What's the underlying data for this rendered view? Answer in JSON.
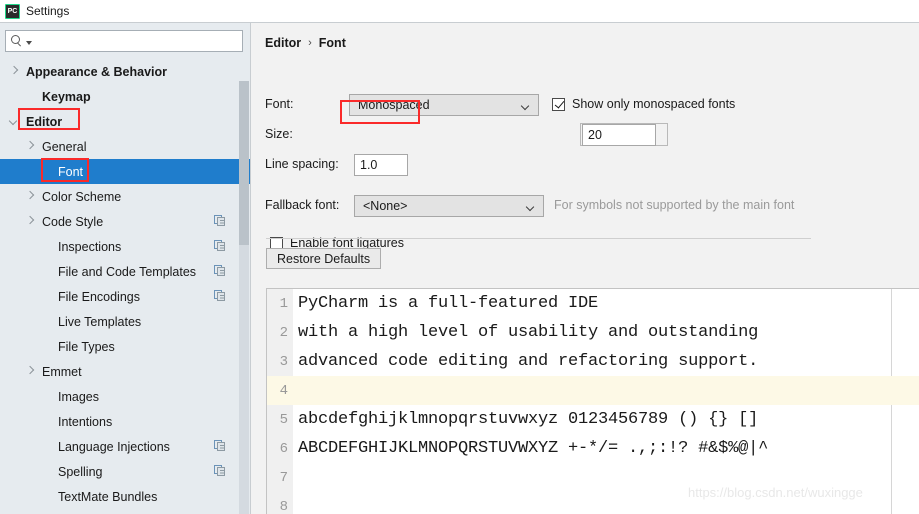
{
  "window": {
    "title": "Settings",
    "app_icon": "pycharm-icon",
    "icon_text": "PC"
  },
  "sidebar": {
    "search": {
      "value": "",
      "placeholder": "",
      "icon": "search-icon"
    },
    "items": [
      {
        "label": "Appearance & Behavior",
        "indent": 0,
        "arrow": "right",
        "bold": true,
        "selected": false,
        "copy_icon": false
      },
      {
        "label": "Keymap",
        "indent": 1,
        "arrow": "none",
        "bold": true,
        "selected": false,
        "copy_icon": false
      },
      {
        "label": "Editor",
        "indent": 0,
        "arrow": "down",
        "bold": true,
        "selected": false,
        "copy_icon": false
      },
      {
        "label": "General",
        "indent": 1,
        "arrow": "right",
        "bold": false,
        "selected": false,
        "copy_icon": false
      },
      {
        "label": "Font",
        "indent": 2,
        "arrow": "none",
        "bold": false,
        "selected": true,
        "copy_icon": false
      },
      {
        "label": "Color Scheme",
        "indent": 1,
        "arrow": "right",
        "bold": false,
        "selected": false,
        "copy_icon": false
      },
      {
        "label": "Code Style",
        "indent": 1,
        "arrow": "right",
        "bold": false,
        "selected": false,
        "copy_icon": true
      },
      {
        "label": "Inspections",
        "indent": 2,
        "arrow": "none",
        "bold": false,
        "selected": false,
        "copy_icon": true
      },
      {
        "label": "File and Code Templates",
        "indent": 2,
        "arrow": "none",
        "bold": false,
        "selected": false,
        "copy_icon": true
      },
      {
        "label": "File Encodings",
        "indent": 2,
        "arrow": "none",
        "bold": false,
        "selected": false,
        "copy_icon": true
      },
      {
        "label": "Live Templates",
        "indent": 2,
        "arrow": "none",
        "bold": false,
        "selected": false,
        "copy_icon": false
      },
      {
        "label": "File Types",
        "indent": 2,
        "arrow": "none",
        "bold": false,
        "selected": false,
        "copy_icon": false
      },
      {
        "label": "Emmet",
        "indent": 1,
        "arrow": "right",
        "bold": false,
        "selected": false,
        "copy_icon": false
      },
      {
        "label": "Images",
        "indent": 2,
        "arrow": "none",
        "bold": false,
        "selected": false,
        "copy_icon": false
      },
      {
        "label": "Intentions",
        "indent": 2,
        "arrow": "none",
        "bold": false,
        "selected": false,
        "copy_icon": false
      },
      {
        "label": "Language Injections",
        "indent": 2,
        "arrow": "none",
        "bold": false,
        "selected": false,
        "copy_icon": true
      },
      {
        "label": "Spelling",
        "indent": 2,
        "arrow": "none",
        "bold": false,
        "selected": false,
        "copy_icon": true
      },
      {
        "label": "TextMate Bundles",
        "indent": 2,
        "arrow": "none",
        "bold": false,
        "selected": false,
        "copy_icon": false
      }
    ]
  },
  "breadcrumb": {
    "root": "Editor",
    "separator": "›",
    "leaf": "Font"
  },
  "form": {
    "font_label": "Font:",
    "font_value": "Monospaced",
    "show_monospaced_label": "Show only monospaced fonts",
    "show_monospaced_checked": true,
    "size_label": "Size:",
    "size_value": "20",
    "line_spacing_label": "Line spacing:",
    "line_spacing_value": "1.0",
    "fallback_label": "Fallback font:",
    "fallback_value": "<None>",
    "fallback_hint": "For symbols not supported by the main font",
    "ligatures_label": "Enable font ligatures",
    "ligatures_checked": false,
    "restore_defaults_label": "Restore Defaults"
  },
  "preview": {
    "lines": [
      {
        "num": "1",
        "text": "PyCharm is a full-featured IDE",
        "highlight": false
      },
      {
        "num": "2",
        "text": "with a high level of usability and outstanding",
        "highlight": false
      },
      {
        "num": "3",
        "text": "advanced code editing and refactoring support.",
        "highlight": false
      },
      {
        "num": "4",
        "text": "",
        "highlight": true
      },
      {
        "num": "5",
        "text": "abcdefghijklmnopqrstuvwxyz 0123456789 () {} []",
        "highlight": false
      },
      {
        "num": "6",
        "text": "ABCDEFGHIJKLMNOPQRSTUVWXYZ +-*/= .,;:!? #&$%@|^",
        "highlight": false
      },
      {
        "num": "7",
        "text": "",
        "highlight": false
      },
      {
        "num": "8",
        "text": "",
        "highlight": false
      }
    ]
  },
  "watermark": {
    "text": "https://blog.csdn.net/wuxingge"
  },
  "colors": {
    "selection": "#1f7dcc",
    "annotation": "#fa2a2a",
    "sidebar_bg": "#e6ebef",
    "panel_bg": "#f2f2f2",
    "caret_line": "#fdf9e6"
  }
}
